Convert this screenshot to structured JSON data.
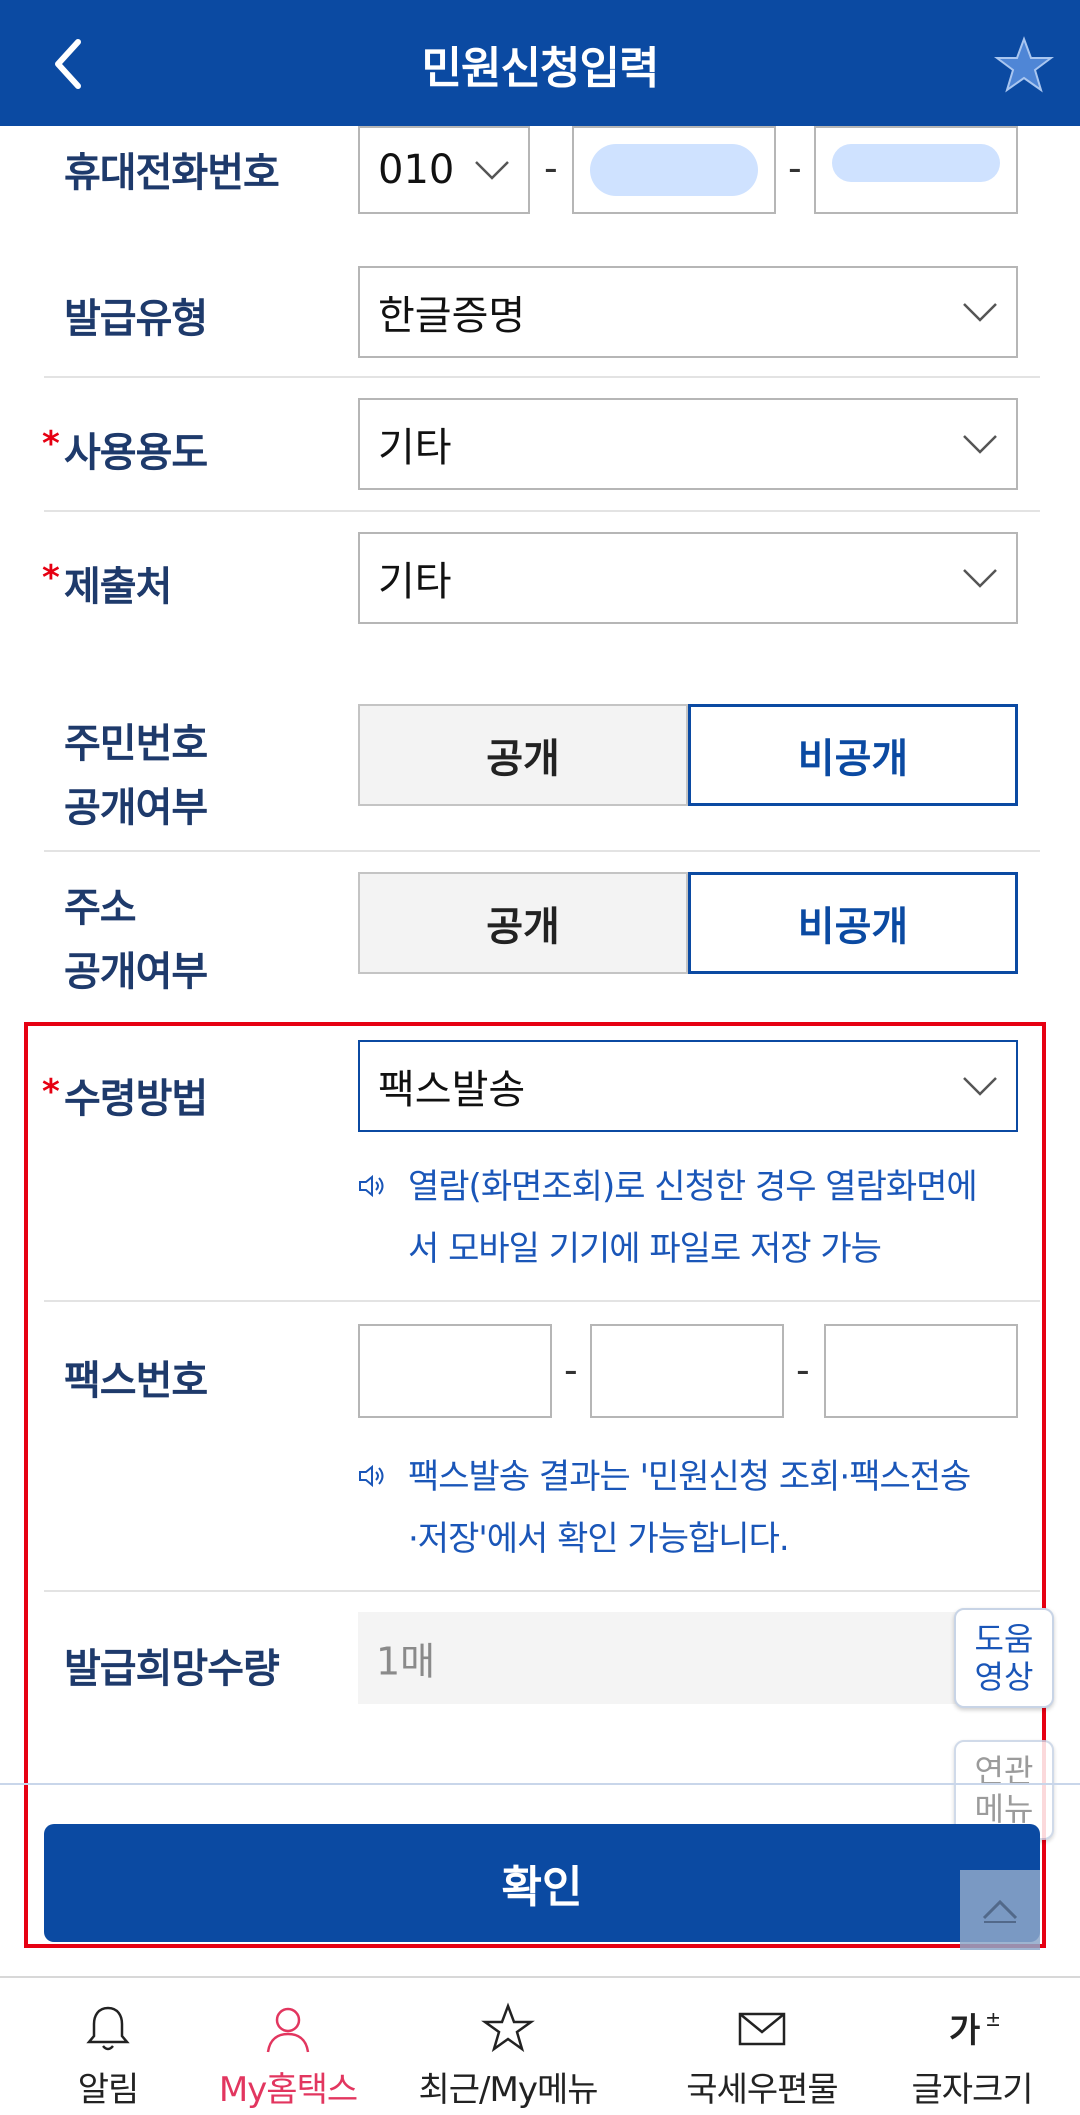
{
  "header": {
    "title": "민원신청입력"
  },
  "form": {
    "phone": {
      "label": "휴대전화번호",
      "prefix": "010"
    },
    "issue_type": {
      "label": "발급유형",
      "value": "한글증명"
    },
    "usage": {
      "label": "사용용도",
      "value": "기타",
      "required_mark": "*"
    },
    "submit_to": {
      "label": "제출처",
      "value": "기타",
      "required_mark": "*"
    },
    "ssn_public": {
      "label_line1": "주민번호",
      "label_line2": "공개여부",
      "option_public": "공개",
      "option_private": "비공개",
      "selected": "비공개"
    },
    "address_public": {
      "label_line1": "주소",
      "label_line2": "공개여부",
      "option_public": "공개",
      "option_private": "비공개",
      "selected": "비공개"
    },
    "receive_method": {
      "label": "수령방법",
      "value": "팩스발송",
      "required_mark": "*",
      "notice_line1": "열람(화면조회)로 신청한 경우 열람화면에",
      "notice_line2": "서 모바일 기기에 파일로 저장 가능"
    },
    "fax_number": {
      "label": "팩스번호",
      "dash": "-",
      "notice_line1": "팩스발송 결과는 '민원신청 조회·팩스전송",
      "notice_line2": "·저장'에서 확인 가능합니다."
    },
    "quantity": {
      "label": "발급희망수량",
      "value": "1매"
    }
  },
  "floating": {
    "help_video_line1": "도움",
    "help_video_line2": "영상",
    "related_menu_line1": "연관",
    "related_menu_line2": "메뉴"
  },
  "confirm_label": "확인",
  "bottom_nav": [
    {
      "label": "알림",
      "icon": "bell-icon"
    },
    {
      "label": "My홈택스",
      "icon": "person-icon",
      "active": true
    },
    {
      "label": "최근/My메뉴",
      "icon": "star-icon"
    },
    {
      "label": "국세우편물",
      "icon": "mail-icon"
    },
    {
      "label": "글자크기",
      "icon": "font-size-icon"
    }
  ],
  "colors": {
    "primary": "#0b4aa2",
    "required": "#e60012",
    "notice": "#1a56b8",
    "active_nav": "#e2365f"
  }
}
